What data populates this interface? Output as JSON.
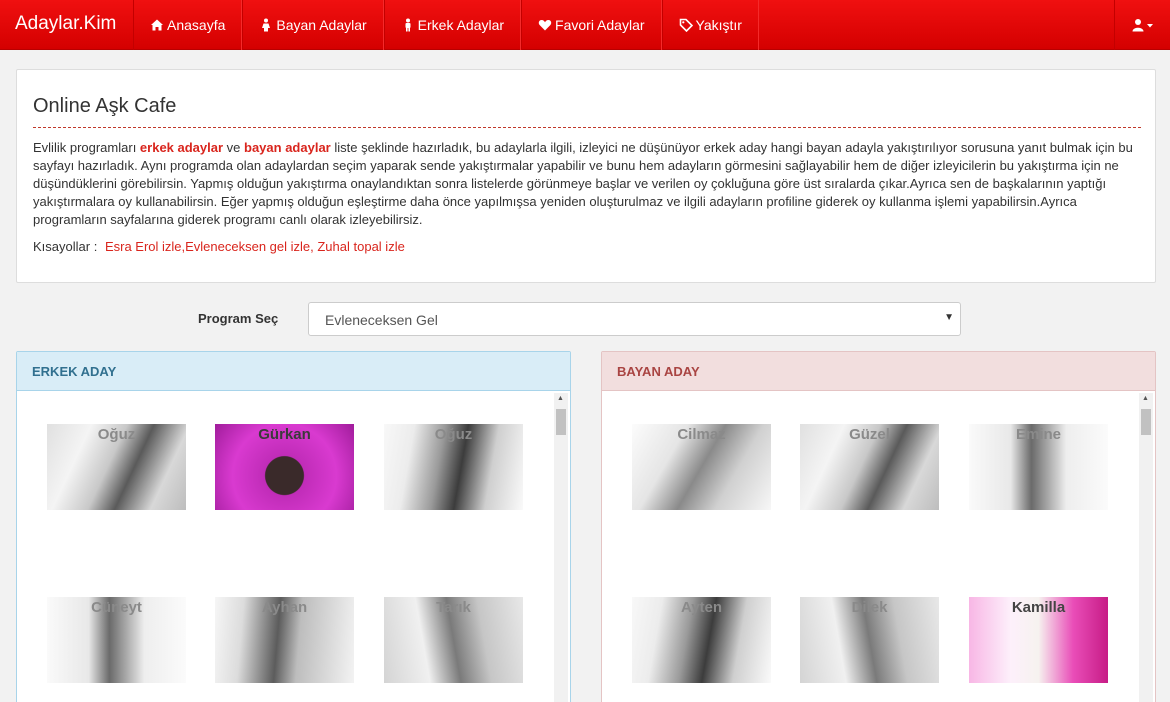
{
  "brand": "Adaylar.Kim",
  "nav": [
    {
      "label": "Anasayfa",
      "icon": "home-icon"
    },
    {
      "label": "Bayan Adaylar",
      "icon": "female-icon"
    },
    {
      "label": "Erkek Adaylar",
      "icon": "male-icon"
    },
    {
      "label": "Favori Adaylar",
      "icon": "heart-icon"
    },
    {
      "label": "Yakıştır",
      "icon": "tag-icon"
    }
  ],
  "user_menu": {
    "icon": "user-icon"
  },
  "info": {
    "title": "Online Aşk Cafe",
    "p_intro": "Evlilik programları ",
    "p_male_link": "erkek adaylar",
    "p_and": " ve ",
    "p_female_link": "bayan adaylar",
    "p_rest": " liste şeklinde hazırladık, bu adaylarla ilgili, izleyici ne düşünüyor erkek aday hangi bayan adayla yakıştırılıyor sorusuna yanıt bulmak için bu sayfayı hazırladık. Aynı programda olan adaylardan seçim yaparak sende yakıştırmalar yapabilir ve bunu hem adayların görmesini sağlayabilir hem de diğer izleyicilerin bu yakıştırma için ne düşündüklerini görebilirsin. Yapmış olduğun yakıştırma onaylandıktan sonra listelerde görünmeye başlar ve verilen oy çokluğuna göre üst sıralarda çıkar.Ayrıca sen de başkalarının yaptığı yakıştırmalara oy kullanabilirsin. Eğer yapmış olduğun eşleştirme daha önce yapılmışsa yeniden oluşturulmaz ve ilgili adayların profiline giderek oy kullanma işlemi yapabilirsin.Ayrıca programların sayfalarına giderek programı canlı olarak izleyebilirsiz.",
    "shortcuts_label": "Kısayollar :",
    "shortcuts": "Esra Erol izle,Evleneceksen gel izle, Zuhal topal izle"
  },
  "program": {
    "label": "Program Seç",
    "selected": "Evleneceksen Gel"
  },
  "male_panel": {
    "title": "ERKEK ADAY",
    "candidates": [
      "Oğuz",
      "Gürkan",
      "Oğuz",
      "Cüneyt",
      "Ayhan",
      "Tarık"
    ]
  },
  "female_panel": {
    "title": "BAYAN ADAY",
    "candidates": [
      "Cilmaz",
      "Güzel",
      "Emine",
      "Ayten",
      "Dilek",
      "Kamilla"
    ]
  },
  "colors": {
    "navbar": "#e00000",
    "accent": "#d9251d",
    "male_head": "#d9edf7",
    "female_head": "#f2dede"
  }
}
